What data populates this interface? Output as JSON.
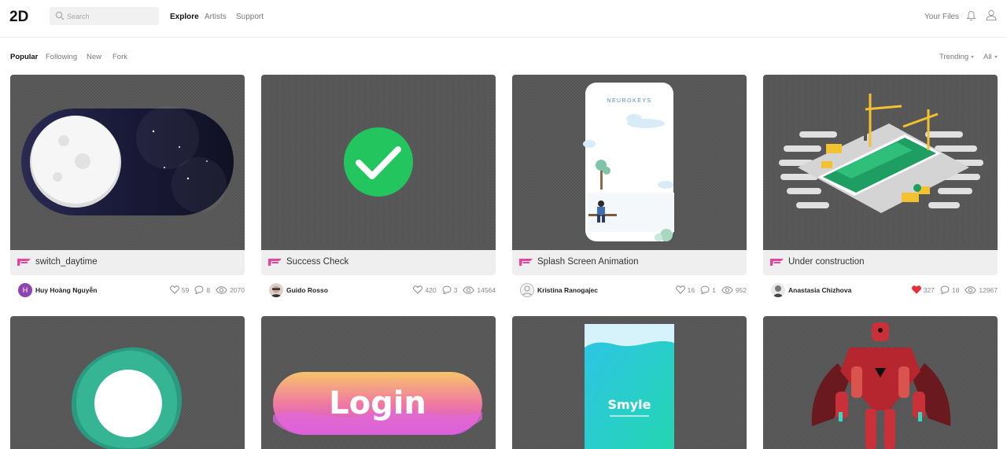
{
  "header": {
    "logo_text": "2D",
    "search_placeholder": "Search",
    "nav": [
      "Explore",
      "Artists",
      "Support"
    ],
    "your_files": "Your Files"
  },
  "filters": {
    "left": [
      "Popular",
      "Following",
      "New",
      "Fork"
    ],
    "sort": "Trending",
    "scope": "All"
  },
  "cards": [
    {
      "title": "switch_daytime",
      "author": "Huy Hoàng Nguyễn",
      "avatar_letter": "H",
      "likes": "59",
      "comments": "8",
      "views": "2070",
      "liked": false
    },
    {
      "title": "Success Check",
      "author": "Guido Rosso",
      "avatar_letter": "",
      "likes": "420",
      "comments": "3",
      "views": "14564",
      "liked": false
    },
    {
      "title": "Splash Screen Animation",
      "author": "Kristina Ranogajec",
      "avatar_letter": "",
      "likes": "16",
      "comments": "1",
      "views": "952",
      "liked": false
    },
    {
      "title": "Under construction",
      "author": "Anastasia Chizhova",
      "avatar_letter": "",
      "likes": "327",
      "comments": "18",
      "views": "12967",
      "liked": true
    }
  ],
  "row2": {
    "login_text": "Login",
    "smyle_text": "Smyle",
    "neurokeys_text": "NEUROKEYS"
  },
  "colors": {
    "accent_flag": "#e8459c",
    "liked_heart": "#e8303a",
    "check_green": "#22c55e"
  }
}
